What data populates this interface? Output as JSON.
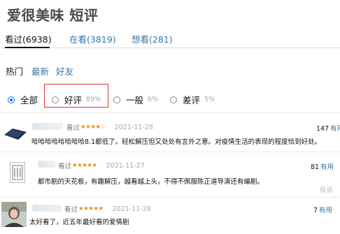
{
  "page": {
    "title": "爱很美味 短评"
  },
  "tabs": [
    {
      "label": "看过(6938)",
      "active": true
    },
    {
      "label": "在看(3819)",
      "active": false
    },
    {
      "label": "想看(281)",
      "active": false
    }
  ],
  "subnav": [
    "热门",
    "最新",
    "好友"
  ],
  "filters": [
    {
      "label": "全部",
      "pct": "",
      "selected": true
    },
    {
      "label": "好评",
      "pct": "89%",
      "selected": false
    },
    {
      "label": "一般",
      "pct": "6%",
      "selected": false
    },
    {
      "label": "差评",
      "pct": "5%",
      "selected": false
    }
  ],
  "reviews": [
    {
      "status": "看过",
      "rating": 4,
      "date": "2021-11-28",
      "useful_count": "147",
      "useful_label": "有用",
      "text": "哈哈哈哈哈哈哈哈8.1都低了。轻松解压但又处处有言外之意。对疫情生活的表现的程度恰到好处。",
      "report": ""
    },
    {
      "status": "看过",
      "rating": 5,
      "date": "2021-11-27",
      "useful_count": "81",
      "useful_label": "有用",
      "text": "都市剧的天花板，有趣解压，越看越上头，不得不佩服陈正道导演还有编剧。",
      "report": "投诉"
    },
    {
      "status": "看过",
      "rating": 5,
      "date": "2021-11-28",
      "useful_count": "7",
      "useful_label": "有用",
      "text": "太好看了，近五年最好看的爱情剧",
      "report": ""
    }
  ],
  "colors": {
    "link": "#3377aa",
    "star": "#e09015",
    "radio_selected": "#1a73e8",
    "highlight_border": "#dd3333"
  },
  "icons": {
    "star": "star-icon",
    "radio": "radio-icon"
  }
}
